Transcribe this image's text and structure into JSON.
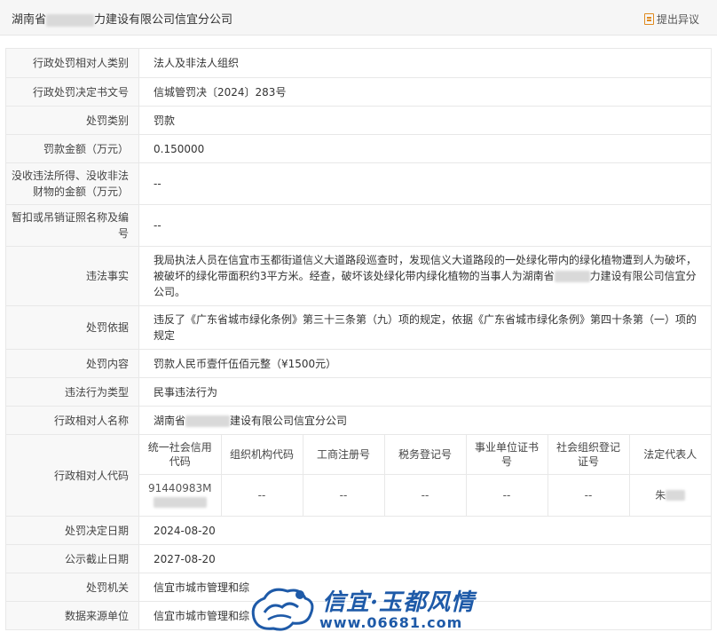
{
  "header": {
    "company_prefix": "湖南省",
    "company_suffix": "力建设有限公司信宜分公司",
    "objection_label": "提出异议",
    "objection_icon": "edit-doc-icon"
  },
  "rows": {
    "party_category": {
      "label": "行政处罚相对人类别",
      "value": "法人及非法人组织"
    },
    "decision_no": {
      "label": "行政处罚决定书文号",
      "value": "信城管罚决〔2024〕283号"
    },
    "penalty_type": {
      "label": "处罚类别",
      "value": "罚款"
    },
    "fine_amount": {
      "label": "罚款金额（万元）",
      "value": "0.150000"
    },
    "confiscation": {
      "label": "没收违法所得、没收非法财物的金额（万元）",
      "value": "--"
    },
    "license_suspend": {
      "label": "暂扣或吊销证照名称及编号",
      "value": "--"
    },
    "violation_facts": {
      "label": "违法事实",
      "value_pre": "我局执法人员在信宜市玉都街道信义大道路段巡查时，发现信义大道路段的一处绿化带内的绿化植物遭到人为破坏，被破坏的绿化带面积约3平方米。经查，破坏该处绿化带内绿化植物的当事人为湖南省",
      "value_post": "力建设有限公司信宜分公司。"
    },
    "penalty_basis": {
      "label": "处罚依据",
      "value": "违反了《广东省城市绿化条例》第三十三条第（九）项的规定，依据《广东省城市绿化条例》第四十条第（一）项的规定"
    },
    "penalty_content": {
      "label": "处罚内容",
      "value": "罚款人民币壹仟伍佰元整（¥1500元）"
    },
    "violation_type": {
      "label": "违法行为类型",
      "value": "民事违法行为"
    },
    "party_name": {
      "label": "行政相对人名称",
      "value_pre": "湖南省",
      "value_post": "建设有限公司信宜分公司"
    },
    "party_code": {
      "label": "行政相对人代码"
    },
    "decision_date": {
      "label": "处罚决定日期",
      "value": "2024-08-20"
    },
    "publish_end": {
      "label": "公示截止日期",
      "value": "2027-08-20"
    },
    "authority": {
      "label": "处罚机关",
      "value": "信宜市城市管理和综"
    },
    "data_source": {
      "label": "数据来源单位",
      "value": "信宜市城市管理和综"
    }
  },
  "codes": {
    "headers": [
      "统一社会信用代码",
      "组织机构代码",
      "工商注册号",
      "税务登记号",
      "事业单位证书号",
      "社会组织登记证号",
      "法定代表人"
    ],
    "values": [
      "91440983M",
      "--",
      "--",
      "--",
      "--",
      "--",
      "朱"
    ]
  },
  "watermark": {
    "title": "信宜·玉都风情",
    "url": "www.06681.com",
    "color": "#1e5aa8"
  }
}
